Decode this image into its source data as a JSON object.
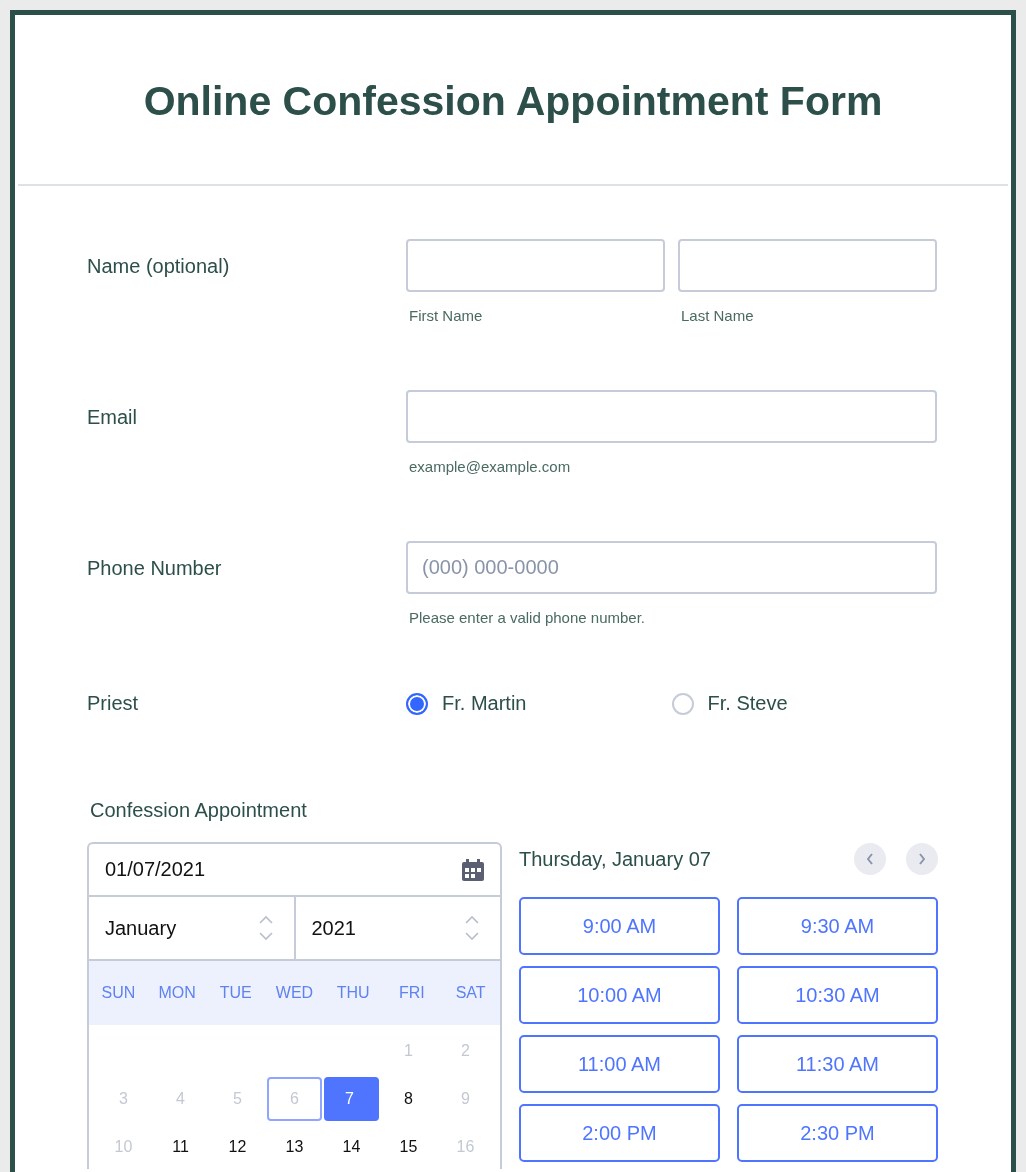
{
  "title": "Online Confession Appointment Form",
  "fields": [
    {
      "kind": "name",
      "label": "Name (optional)",
      "inputs": [
        {
          "sublabel": "First Name"
        },
        {
          "sublabel": "Last Name"
        }
      ]
    },
    {
      "kind": "text",
      "label": "Email",
      "inputs": [
        {
          "sublabel": "example@example.com"
        }
      ]
    },
    {
      "kind": "text",
      "label": "Phone Number",
      "inputs": [
        {
          "placeholder": "(000) 000-0000",
          "sublabel": "Please enter a valid phone number."
        }
      ]
    },
    {
      "kind": "radio",
      "label": "Priest",
      "options": [
        {
          "label": "Fr. Martin",
          "selected": true
        },
        {
          "label": "Fr. Steve",
          "selected": false
        }
      ]
    }
  ],
  "appointment": {
    "label": "Confession Appointment",
    "date_value": "01/07/2021",
    "month": "January",
    "year": "2021",
    "weekdays": [
      "SUN",
      "MON",
      "TUE",
      "WED",
      "THU",
      "FRI",
      "SAT"
    ],
    "weeks": [
      [
        {
          "day": "1",
          "available": false,
          "selected": false,
          "today": false
        },
        {
          "day": "2",
          "available": false,
          "selected": false,
          "today": false
        }
      ],
      [
        {
          "day": "3",
          "available": false,
          "selected": false,
          "today": false
        },
        {
          "day": "4",
          "available": false,
          "selected": false,
          "today": false
        },
        {
          "day": "5",
          "available": false,
          "selected": false,
          "today": false
        },
        {
          "day": "6",
          "available": false,
          "selected": false,
          "today": true
        },
        {
          "day": "7",
          "available": true,
          "selected": true,
          "today": false
        },
        {
          "day": "8",
          "available": true,
          "selected": false,
          "today": false
        },
        {
          "day": "9",
          "available": false,
          "selected": false,
          "today": false
        }
      ],
      [
        {
          "day": "10",
          "available": false,
          "selected": false,
          "today": false
        },
        {
          "day": "11",
          "available": true,
          "selected": false,
          "today": false
        },
        {
          "day": "12",
          "available": true,
          "selected": false,
          "today": false
        },
        {
          "day": "13",
          "available": true,
          "selected": false,
          "today": false
        },
        {
          "day": "14",
          "available": true,
          "selected": false,
          "today": false
        },
        {
          "day": "15",
          "available": true,
          "selected": false,
          "today": false
        },
        {
          "day": "16",
          "available": false,
          "selected": false,
          "today": false
        }
      ]
    ],
    "selected_date": "Thursday, January 07",
    "slots": [
      {
        "time": "9:00 AM",
        "selected": false
      },
      {
        "time": "9:30 AM",
        "selected": false
      },
      {
        "time": "10:00 AM",
        "selected": false
      },
      {
        "time": "10:30 AM",
        "selected": false
      },
      {
        "time": "11:00 AM",
        "selected": false
      },
      {
        "time": "11:30 AM",
        "selected": false
      },
      {
        "time": "2:00 PM",
        "selected": false
      },
      {
        "time": "2:30 PM",
        "selected": false
      }
    ]
  }
}
